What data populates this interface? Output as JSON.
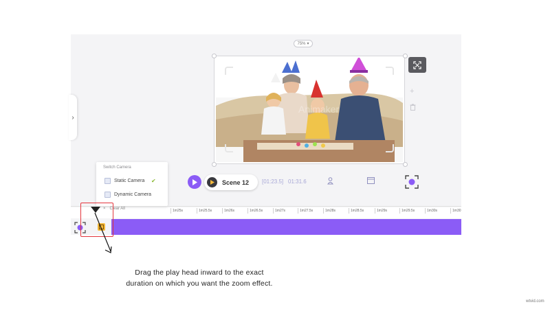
{
  "stage": {
    "zoom_level": "75%",
    "image_watermark": "Animaker"
  },
  "controls": {
    "scene_label": "Scene 12",
    "time_range": "[01:23.5]",
    "time_total": "01:31.6"
  },
  "camera_menu": {
    "title": "Switch Camera",
    "items": [
      {
        "label": "Static Camera",
        "selected": true
      },
      {
        "label": "Dynamic Camera",
        "selected": false
      }
    ]
  },
  "timeline": {
    "clear_label": "Clear All",
    "ticks": [
      "1m25s",
      "1m25.5s",
      "1m26s",
      "1m26.5s",
      "1m27s",
      "1m27.5s",
      "1m28s",
      "1m28.5s",
      "1m29s",
      "1m29.5s",
      "1m30s",
      "1m30"
    ]
  },
  "caption": {
    "line1": "Drag the play head inward to the exact",
    "line2": "duration on which you want the  zoom effect."
  },
  "footer": {
    "watermark": "wtvid.com"
  },
  "colors": {
    "accent": "#8b5cf6",
    "highlight": "#e3343c",
    "chip": "#f5b93a"
  }
}
